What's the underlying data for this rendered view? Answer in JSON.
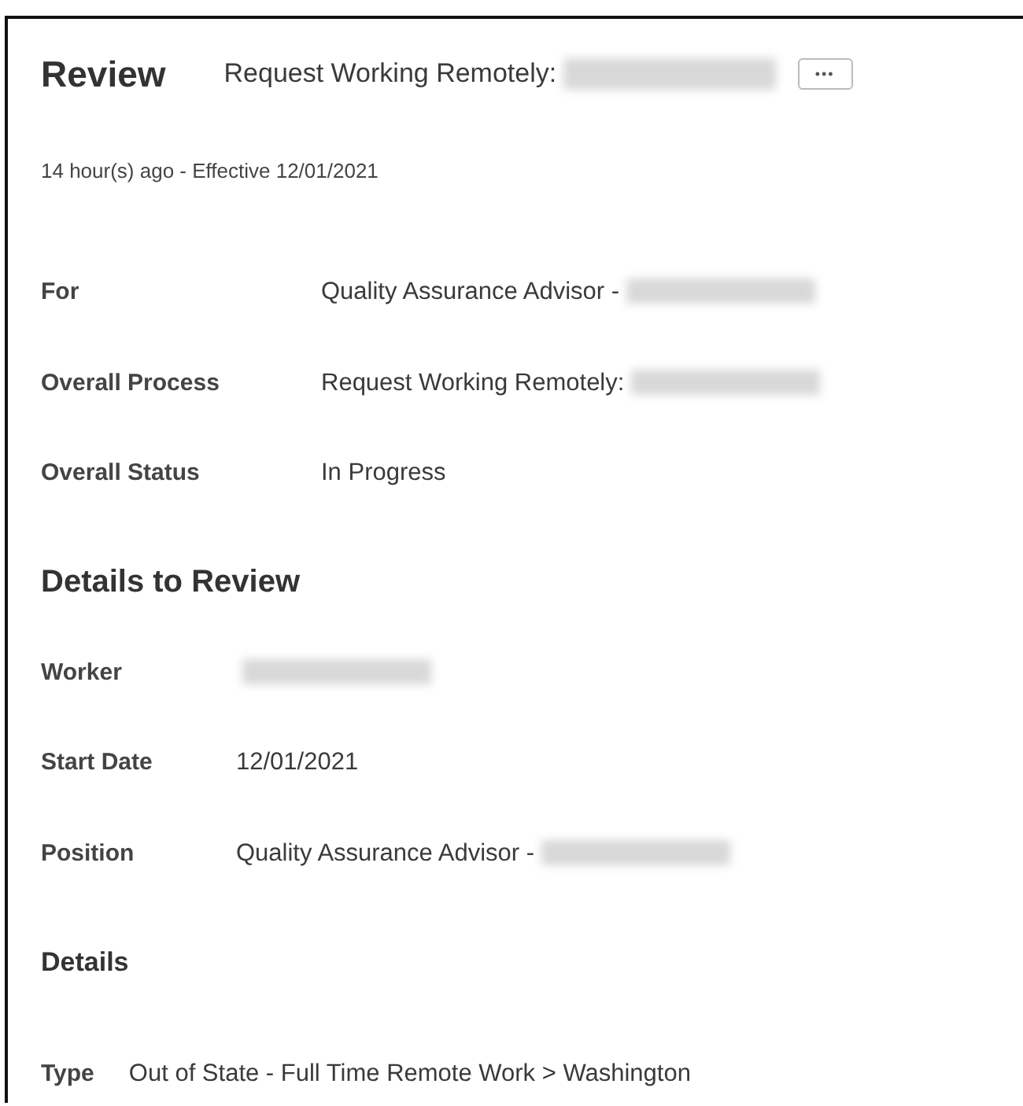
{
  "header": {
    "title": "Review",
    "subtitle": "Request Working Remotely:",
    "subtitle_redacted": true,
    "menu_button": "•••"
  },
  "meta": "14 hour(s) ago -  Effective 12/01/2021",
  "summary": [
    {
      "label": "For",
      "value": "Quality Assurance Advisor -",
      "redacted": true
    },
    {
      "label": "Overall Process",
      "value": "Request Working Remotely:",
      "redacted": true
    },
    {
      "label": "Overall Status",
      "value": "In Progress",
      "redacted": false
    }
  ],
  "details_heading": "Details to Review",
  "details": [
    {
      "label": "Worker",
      "redacted": true
    },
    {
      "label": "Start Date",
      "value": "12/01/2021",
      "redacted": false
    },
    {
      "label": "Position",
      "value": "Quality Assurance Advisor -",
      "redacted": true
    }
  ],
  "sub_heading": "Details",
  "type_row": {
    "label": "Type",
    "value": "Out of State - Full Time Remote Work > Washington"
  }
}
